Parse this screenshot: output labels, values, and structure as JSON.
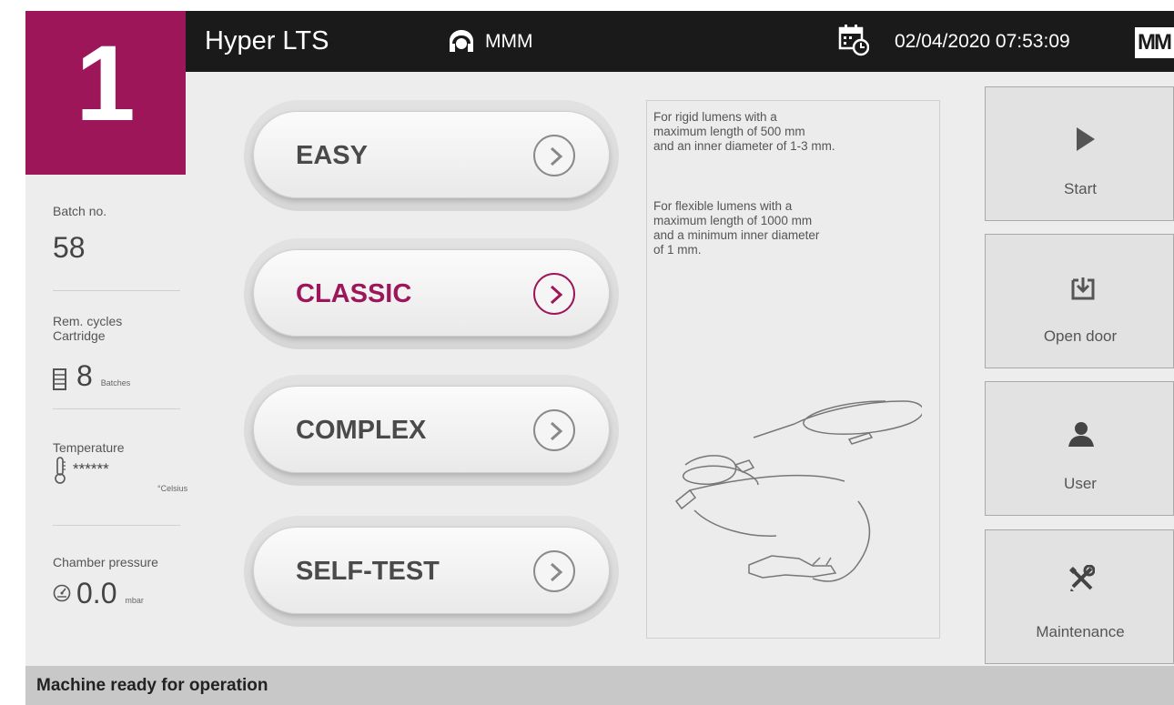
{
  "header": {
    "machine_number": "1",
    "app_title": "Hyper LTS",
    "user_name": "MMM",
    "datetime": "02/04/2020 07:53:09",
    "logo_text": "MM"
  },
  "stats": {
    "batch_label": "Batch no.",
    "batch_value": "58",
    "cycles_label_line1": "Rem. cycles",
    "cycles_label_line2": "Cartridge",
    "cycles_value": "8",
    "cycles_unit": "Batches",
    "temperature_label": "Temperature",
    "temperature_value": "******",
    "temperature_unit": "°Celsius",
    "pressure_label": "Chamber pressure",
    "pressure_value": "0.0",
    "pressure_unit": "mbar"
  },
  "programs": [
    {
      "label": "EASY",
      "active": false
    },
    {
      "label": "CLASSIC",
      "active": true
    },
    {
      "label": "COMPLEX",
      "active": false
    },
    {
      "label": "SELF-TEST",
      "active": false
    }
  ],
  "description": {
    "rigid_line1": "For rigid lumens with a",
    "rigid_line2": "maximum length of 500 mm",
    "rigid_line3": "and an inner diameter of 1-3 mm.",
    "flexible_line1": "For flexible lumens with a",
    "flexible_line2": "maximum length of 1000 mm",
    "flexible_line3": "and a minimum inner diameter",
    "flexible_line4": "of 1 mm."
  },
  "actions": {
    "start": "Start",
    "open_door": "Open door",
    "user": "User",
    "maintenance": "Maintenance"
  },
  "status": {
    "message": "Machine ready for operation"
  },
  "colors": {
    "accent": "#9c1659",
    "header_bg": "#1a1a1a",
    "screen_bg": "#ededed",
    "status_bg": "#c8c8c8"
  }
}
